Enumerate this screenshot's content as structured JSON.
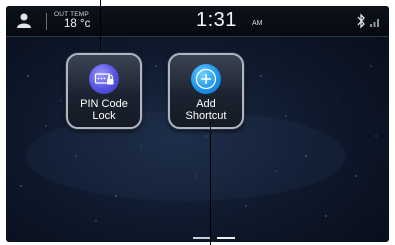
{
  "status_bar": {
    "outside_temp_label": "OUT TEMP",
    "outside_temp_value": "18 °c",
    "time": "1:31",
    "ampm": "AM",
    "icons": [
      "user-icon",
      "bluetooth-icon",
      "signal-strength-icon"
    ]
  },
  "home": {
    "shortcuts": [
      {
        "line1": "PIN Code",
        "line2": "Lock",
        "icon": "keypad-lock-icon",
        "icon_color": "#5a57e6"
      },
      {
        "line1": "Add",
        "line2": "Shortcut",
        "icon": "plus-icon",
        "icon_color": "#1c95ee"
      }
    ],
    "page_indicator": {
      "pages": 2,
      "current": 2
    }
  },
  "colors": {
    "background": "#0f1a2e",
    "tile_border": "#aeb5c2"
  }
}
